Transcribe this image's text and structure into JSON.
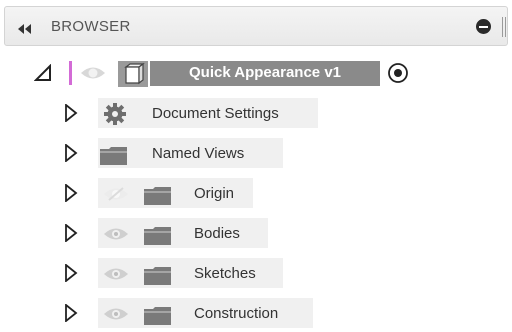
{
  "panel": {
    "title": "BROWSER"
  },
  "root": {
    "label": "Quick Appearance v1",
    "marker_color": "#d36bd6"
  },
  "items": [
    {
      "label": "Document Settings",
      "icon": "gear-icon"
    },
    {
      "label": "Named Views",
      "icon": "folder-icon"
    },
    {
      "label": "Origin",
      "icon": "folder-icon",
      "visibility": "hidden"
    },
    {
      "label": "Bodies",
      "icon": "folder-icon",
      "visibility": "visible"
    },
    {
      "label": "Sketches",
      "icon": "folder-icon",
      "visibility": "visible"
    },
    {
      "label": "Construction",
      "icon": "folder-icon",
      "visibility": "visible"
    }
  ]
}
